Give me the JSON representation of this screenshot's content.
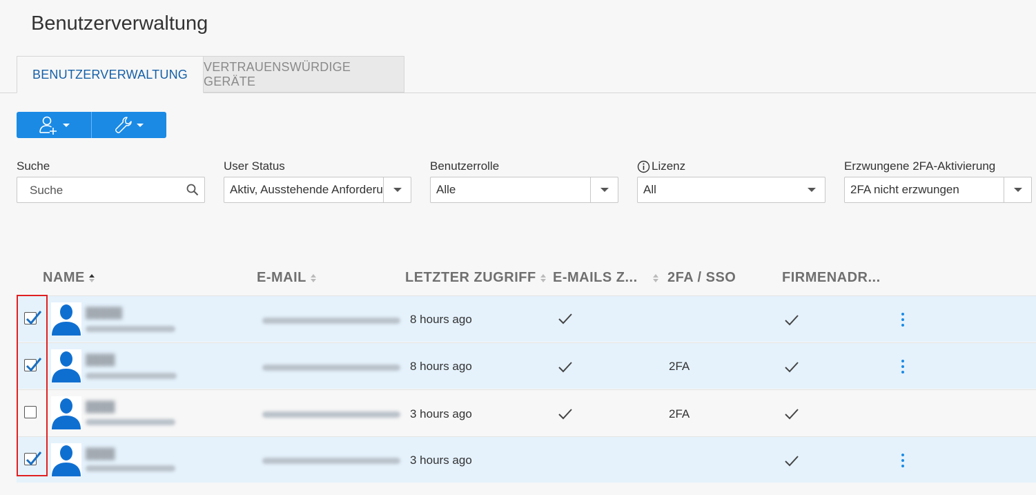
{
  "page": {
    "title": "Benutzerverwaltung"
  },
  "tabs": [
    {
      "label": "BENUTZERVERWALTUNG",
      "active": true
    },
    {
      "label": "VERTRAUENSWÜRDIGE GERÄTE",
      "active": false
    }
  ],
  "toolbar": {
    "add_user_icon": "add-user-icon",
    "tools_icon": "wrench-icon",
    "accent_color": "#1a8ae5"
  },
  "filters": {
    "search": {
      "label": "Suche",
      "placeholder": "Suche"
    },
    "user_status": {
      "label": "User Status",
      "value": "Aktiv, Ausstehende Anforderu"
    },
    "role": {
      "label": "Benutzerrolle",
      "value": "Alle"
    },
    "license": {
      "label": "Lizenz",
      "value": "All"
    },
    "twofa": {
      "label": "Erzwungene 2FA-Aktivierung",
      "value": "2FA nicht erzwungen"
    }
  },
  "table": {
    "columns": [
      "NAME",
      "E-MAIL",
      "LETZTER ZUGRIFF",
      "E-MAILS Z...",
      "2FA / SSO",
      "FIRMENADR..."
    ],
    "rows": [
      {
        "selected": true,
        "last_access": "8 hours ago",
        "emails_check": true,
        "twofa": "",
        "company_check": true,
        "has_menu": true
      },
      {
        "selected": true,
        "last_access": "8 hours ago",
        "emails_check": true,
        "twofa": "2FA",
        "company_check": true,
        "has_menu": true
      },
      {
        "selected": false,
        "last_access": "3 hours ago",
        "emails_check": true,
        "twofa": "2FA",
        "company_check": true,
        "has_menu": false
      },
      {
        "selected": true,
        "last_access": "3 hours ago",
        "emails_check": false,
        "twofa": "",
        "company_check": true,
        "has_menu": true
      }
    ]
  }
}
